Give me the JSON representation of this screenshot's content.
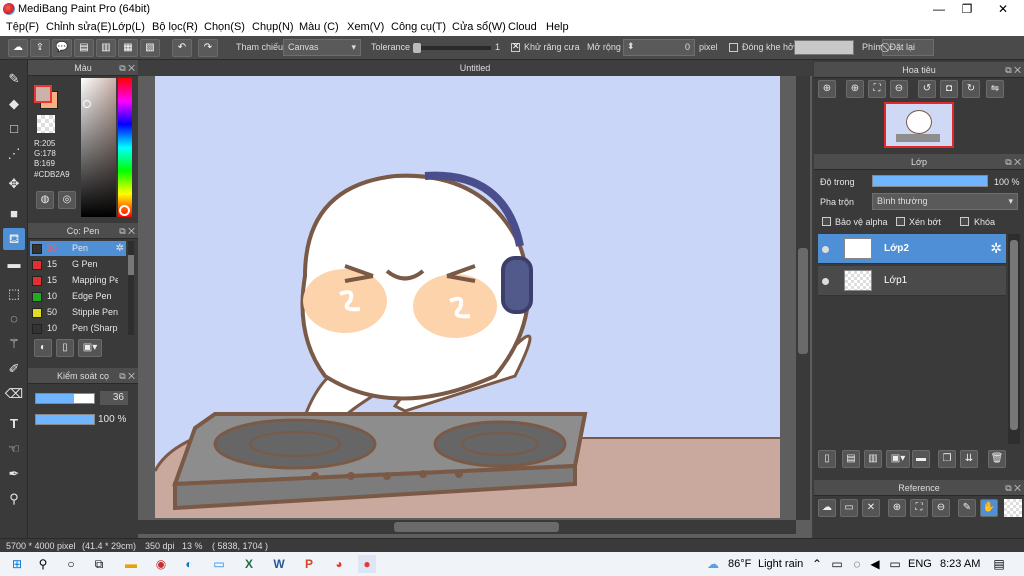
{
  "window": {
    "title": "MediBang Paint Pro (64bit)",
    "min": "—",
    "max": "❐",
    "close": "✕"
  },
  "menu": [
    "Tệp(F)",
    "Chỉnh sửa(E)",
    "Lớp(L)",
    "Bộ lọc(R)",
    "Chọn(S)",
    "Chụp(N)",
    "Màu (C)",
    "Xem(V)",
    "Công cụ(T)",
    "Cửa sổ(W)",
    "Cloud",
    "Help"
  ],
  "toolbar": {
    "reference_label": "Tham chiếu",
    "reference_value": "Canvas",
    "tolerance_label": "Tolerance",
    "tolerance_value": "1",
    "tolerance_fraction": 0.0,
    "antialias_label": "Khử răng cưa",
    "antialias_checked": true,
    "expand_label": "Mở rộng",
    "expand_value": "0",
    "expand_unit": "pixel",
    "close_gap_label": "Đóng khe hở",
    "close_gap_checked": false,
    "key_label": "Phím",
    "reset_label": "Đặt lại"
  },
  "color_panel": {
    "title": "Màu",
    "r": "R:205",
    "g": "G:178",
    "b": "B:169",
    "hex": "#CDB2A9",
    "foreground": "#CDB2A9",
    "background_swatch": "#F4B183"
  },
  "brush_panel": {
    "title": "Cọ: Pen",
    "items": [
      {
        "size": "36",
        "name": "Pen",
        "color": "#333333"
      },
      {
        "size": "15",
        "name": "G Pen",
        "color": "#e03030"
      },
      {
        "size": "15",
        "name": "Mapping Pen",
        "color": "#e03030"
      },
      {
        "size": "10",
        "name": "Edge Pen",
        "color": "#22aa22"
      },
      {
        "size": "50",
        "name": "Stipple Pen",
        "color": "#dddd22"
      },
      {
        "size": "10",
        "name": "Pen (Sharp)",
        "color": "#333333"
      }
    ]
  },
  "brush_control": {
    "title": "Kiểm soát cọ",
    "size": "36",
    "size_fraction": 0.65,
    "opacity": "100 %",
    "opacity_fraction": 1.0
  },
  "document": {
    "tab": "Untitled"
  },
  "navigator": {
    "title": "Hoa tiêu"
  },
  "layer_panel": {
    "title": "Lớp",
    "opacity_label": "Độ trong",
    "opacity_value": "100 %",
    "opacity_fraction": 1.0,
    "blend_label": "Pha trộn",
    "blend_value": "Bình thường",
    "protect_alpha": "Bảo vệ alpha",
    "clipping": "Xén bớt",
    "lock": "Khóa",
    "layers": [
      {
        "name": "Lớp2",
        "active": true
      },
      {
        "name": "Lớp1",
        "active": false
      }
    ]
  },
  "reference_panel": {
    "title": "Reference"
  },
  "status": {
    "size": "5700 * 4000 pixel",
    "cm": "(41.4 * 29cm)",
    "dpi": "350 dpi",
    "zoom": "13 %",
    "coords": "( 5838, 1704 )"
  },
  "taskbar": {
    "weather_temp": "86°F",
    "weather_text": "Light rain",
    "lang": "ENG",
    "time": "8:23 AM"
  }
}
